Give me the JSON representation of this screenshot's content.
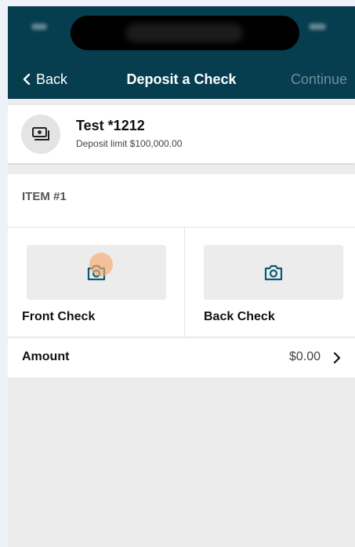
{
  "nav": {
    "back_label": "Back",
    "title": "Deposit a Check",
    "continue_label": "Continue"
  },
  "account": {
    "name": "Test *1212",
    "limit": "Deposit limit $100,000.00",
    "icon": "money-icon"
  },
  "item": {
    "label": "ITEM #1"
  },
  "checks": {
    "front_label": "Front Check",
    "back_label": "Back Check",
    "icon": "camera-icon"
  },
  "amount": {
    "label": "Amount",
    "value": "$0.00"
  },
  "colors": {
    "header_bg": "#063d4f",
    "accent": "#0b5a73",
    "continue_disabled": "#6e8f9b",
    "background": "#ececec"
  }
}
